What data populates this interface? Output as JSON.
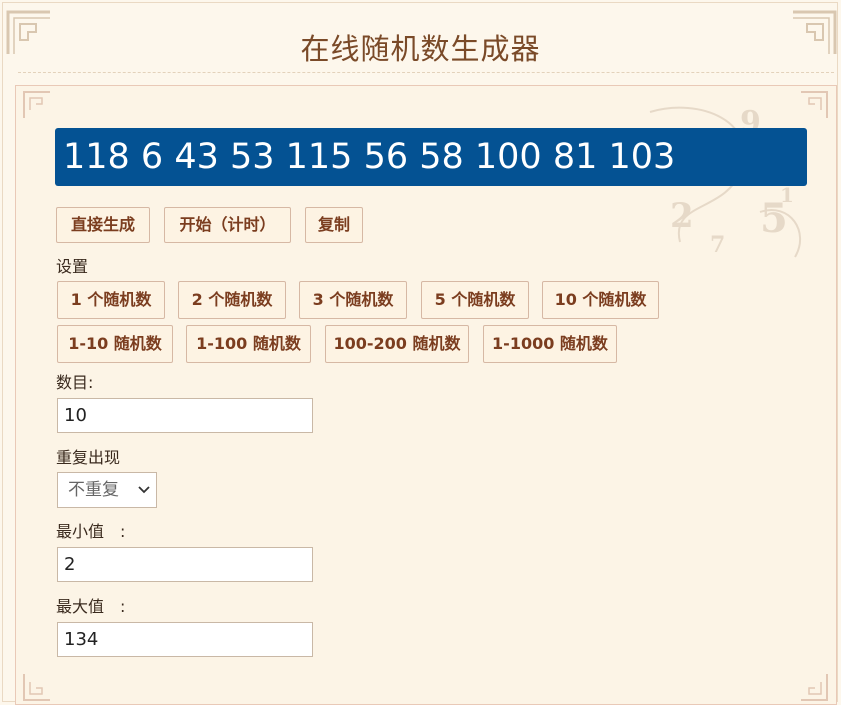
{
  "page": {
    "title": "在线随机数生成器"
  },
  "result": {
    "numbers": "118 6 43 53 115 56 58 100 81 103"
  },
  "actions": {
    "generate_label": "直接生成",
    "start_label": "开始（计时）",
    "copy_label": "复制"
  },
  "settings": {
    "heading": "设置",
    "presets_count": [
      "1 个随机数",
      "2 个随机数",
      "3 个随机数",
      "5 个随机数",
      "10 个随机数"
    ],
    "presets_range": [
      "1-10 随机数",
      "1-100 随机数",
      "100-200 随机数",
      "1-1000 随机数"
    ]
  },
  "form": {
    "count_label": "数目:",
    "count_value": "10",
    "repeat_label": "重复出现",
    "repeat_value": "不重复",
    "min_label": "最小值　:",
    "min_value": "2",
    "max_label": "最大值　:",
    "max_value": "134"
  },
  "colors": {
    "display_bg": "#045293",
    "button_text": "#7b3d1f",
    "title_color": "#7a4a28",
    "page_bg": "#fdf7ec"
  },
  "icons": {
    "select_arrow": "chevron-down-icon",
    "frame_corner": "ornament-corner-icon"
  }
}
